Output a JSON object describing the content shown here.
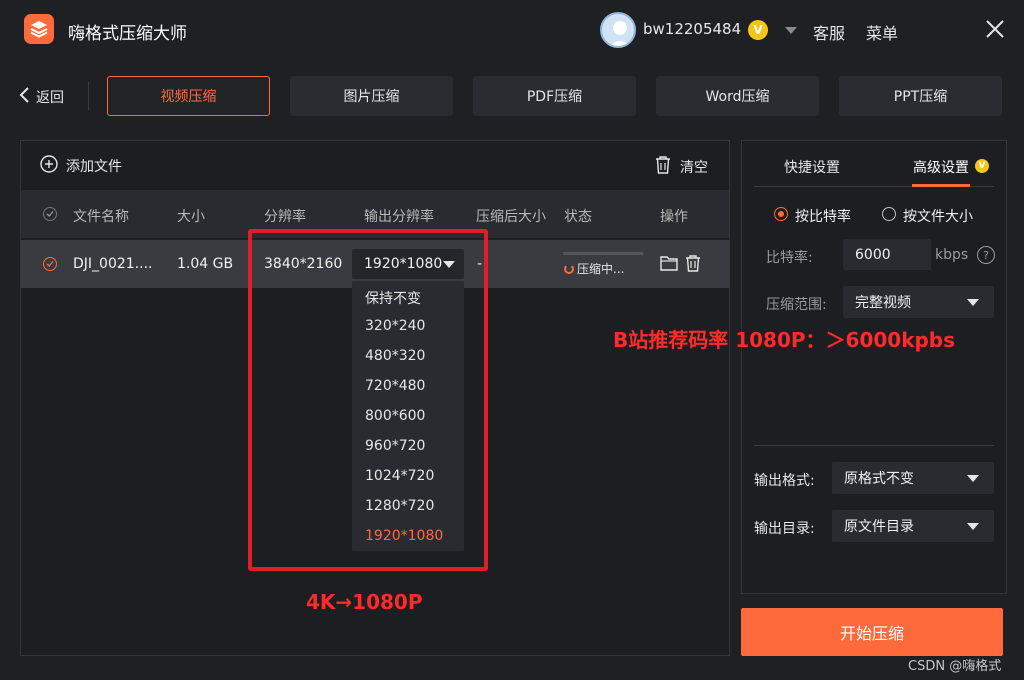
{
  "app": {
    "title": "嗨格式压缩大师"
  },
  "header": {
    "username": "bw12205484",
    "vip_badge": "V",
    "service": "客服",
    "menu": "菜单"
  },
  "nav": {
    "back": "返回",
    "tabs": [
      {
        "label": "视频压缩",
        "active": true
      },
      {
        "label": "图片压缩"
      },
      {
        "label": "PDF压缩"
      },
      {
        "label": "Word压缩"
      },
      {
        "label": "PPT压缩"
      }
    ]
  },
  "toolbar": {
    "add_file": "添加文件",
    "clear": "清空"
  },
  "table": {
    "columns": [
      "文件名称",
      "大小",
      "分辨率",
      "输出分辨率",
      "压缩后大小",
      "状态",
      "操作"
    ],
    "rows": [
      {
        "name": "DJI_0021....",
        "size": "1.04 GB",
        "resolution": "3840*2160",
        "output_resolution": "1920*1080",
        "compressed_size": "-",
        "status": "压缩中..."
      }
    ]
  },
  "resolution_dropdown": {
    "options": [
      "保持不变",
      "320*240",
      "480*320",
      "720*480",
      "800*600",
      "960*720",
      "1024*720",
      "1280*720",
      "1920*1080"
    ],
    "selected": "1920*1080"
  },
  "settings": {
    "tab_quick": "快捷设置",
    "tab_advanced": "高级设置",
    "radio_bitrate": "按比特率",
    "radio_filesize": "按文件大小",
    "bitrate_label": "比特率:",
    "bitrate_value": "6000",
    "bitrate_unit": "kbps",
    "range_label": "压缩范围:",
    "range_value": "完整视频",
    "format_label": "输出格式:",
    "format_value": "原格式不变",
    "dir_label": "输出目录:",
    "dir_value": "原文件目录"
  },
  "actions": {
    "start": "开始压缩"
  },
  "annotations": {
    "bitrate_note": "B站推荐码率 1080P：＞6000kpbs",
    "resolution_note": "4K→1080P"
  },
  "watermark": "CSDN @嗨格式",
  "colors": {
    "accent": "#ff6a3d",
    "annotation": "#ff2a2a",
    "background": "#1f2024"
  }
}
